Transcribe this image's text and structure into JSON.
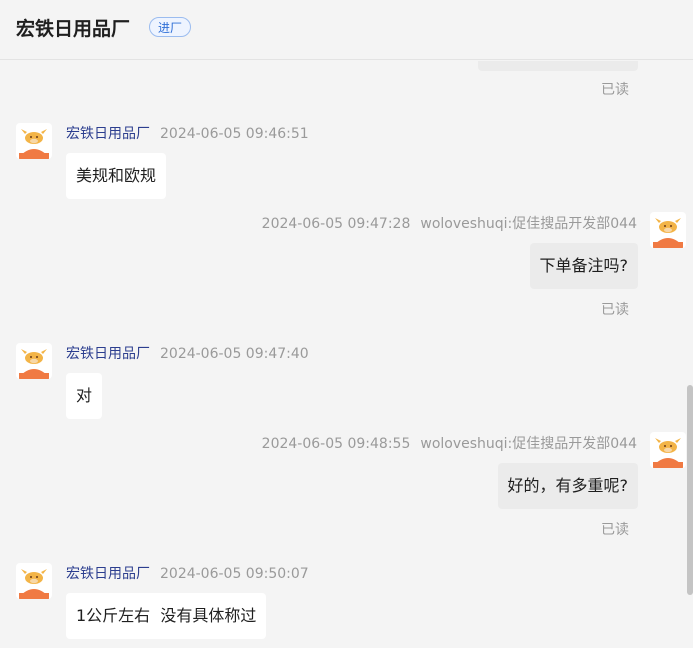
{
  "header": {
    "title": "宏铁日用品厂",
    "tag": "进厂"
  },
  "chat": {
    "read_label": "已读",
    "messages": [
      {
        "direction": "in",
        "sender": "宏铁日用品厂",
        "time": "2024-06-05 09:46:51",
        "text": "美规和欧规"
      },
      {
        "direction": "out",
        "sender": "woloveshuqi:促佳搜品开发部044",
        "time": "2024-06-05 09:47:28",
        "text": "下单备注吗?",
        "status": "已读"
      },
      {
        "direction": "in",
        "sender": "宏铁日用品厂",
        "time": "2024-06-05 09:47:40",
        "text": "对"
      },
      {
        "direction": "out",
        "sender": "woloveshuqi:促佳搜品开发部044",
        "time": "2024-06-05 09:48:55",
        "text": "好的，有多重呢?",
        "status": "已读"
      },
      {
        "direction": "in",
        "sender": "宏铁日用品厂",
        "time": "2024-06-05 09:50:07",
        "text": "1公斤左右  没有具体称过"
      }
    ]
  },
  "colors": {
    "accent": "#2f6fd6",
    "sender_name": "#2c3e8f",
    "avatar_orange": "#f07a43"
  }
}
